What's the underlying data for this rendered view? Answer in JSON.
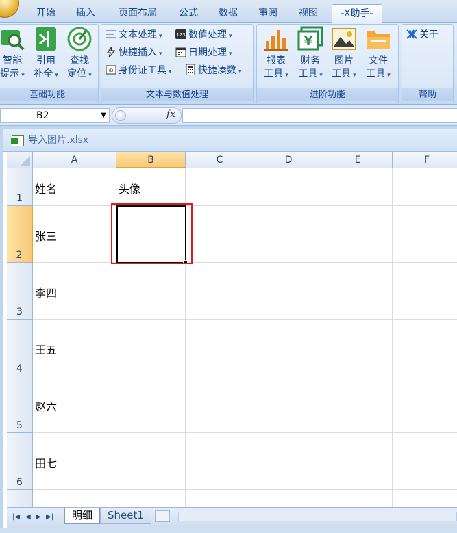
{
  "ribbon_tabs": [
    {
      "label": "开始",
      "active": false
    },
    {
      "label": "插入",
      "active": false
    },
    {
      "label": "页面布局",
      "active": false
    },
    {
      "label": "公式",
      "active": false
    },
    {
      "label": "数据",
      "active": false
    },
    {
      "label": "审阅",
      "active": false
    },
    {
      "label": "视图",
      "active": false
    },
    {
      "label": "-X助手-",
      "active": true
    }
  ],
  "groups": {
    "basic": {
      "label": "基础功能",
      "buttons": [
        {
          "line1": "智能",
          "line2": "提示",
          "icon": "magnifier-icon"
        },
        {
          "line1": "引用",
          "line2": "补全",
          "icon": "arrow-into-bracket-icon"
        },
        {
          "line1": "查找",
          "line2": "定位",
          "icon": "target-icon"
        }
      ]
    },
    "text_num": {
      "label": "文本与数值处理",
      "items": [
        {
          "label": "文本处理",
          "icon": "text-lines-icon"
        },
        {
          "label": "数值处理",
          "icon": "number-123-icon"
        },
        {
          "label": "快捷插入",
          "icon": "lightning-icon"
        },
        {
          "label": "日期处理",
          "icon": "calendar-icon"
        },
        {
          "label": "身份证工具",
          "icon": "id-card-icon"
        },
        {
          "label": "快捷凑数",
          "icon": "calculator-icon"
        }
      ]
    },
    "advanced": {
      "label": "进阶功能",
      "buttons": [
        {
          "line1": "报表",
          "line2": "工具",
          "icon": "bar-chart-icon"
        },
        {
          "line1": "财务",
          "line2": "工具",
          "icon": "yen-icon"
        },
        {
          "line1": "图片",
          "line2": "工具",
          "icon": "picture-icon"
        },
        {
          "line1": "文件",
          "line2": "工具",
          "icon": "folder-icon"
        }
      ]
    },
    "help": {
      "label": "帮助",
      "about": "关于",
      "icon": "x-logo-icon"
    }
  },
  "formula_bar": {
    "name_box": "B2",
    "fx": "fx",
    "formula": ""
  },
  "workbook": {
    "title": "导入图片.xlsx"
  },
  "grid": {
    "columns": [
      "A",
      "B",
      "C",
      "D",
      "E",
      "F"
    ],
    "selected_column": "B",
    "rows": [
      {
        "num": "1",
        "a": "姓名",
        "b": "头像"
      },
      {
        "num": "2",
        "a": "张三",
        "b": ""
      },
      {
        "num": "3",
        "a": "李四",
        "b": ""
      },
      {
        "num": "4",
        "a": "王五",
        "b": ""
      },
      {
        "num": "5",
        "a": "赵六",
        "b": ""
      },
      {
        "num": "6",
        "a": "田七",
        "b": ""
      }
    ],
    "selected_row": "2",
    "active_cell": "B2"
  },
  "sheets": [
    {
      "label": "明细",
      "active": true
    },
    {
      "label": "Sheet1",
      "active": false
    }
  ],
  "colors": {
    "highlight": "#e11a1a",
    "selection_header": "#f8c977"
  }
}
